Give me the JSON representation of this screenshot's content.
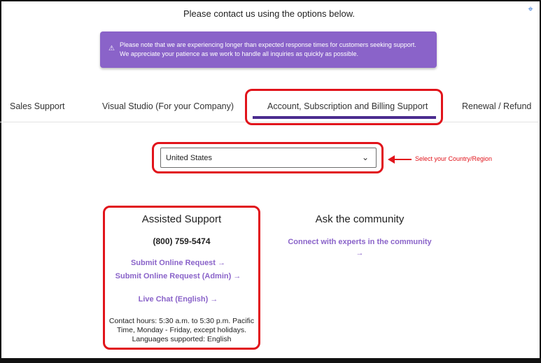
{
  "intro": "Please contact us using the options below.",
  "banner": {
    "icon": "warning-icon",
    "line1": "Please note that we are experiencing longer than expected response times for customers seeking support.",
    "line2": "We appreciate your patience as we work to handle all inquiries as quickly as possible."
  },
  "tabs": [
    {
      "label": "Sales Support"
    },
    {
      "label": "Visual Studio (For your Company)"
    },
    {
      "label": "Account, Subscription and Billing Support",
      "selected": true
    },
    {
      "label": "Renewal / Refund"
    }
  ],
  "country_select": {
    "value": "United States"
  },
  "annotation": {
    "label": "Select your Country/Region",
    "color": "#e1141b"
  },
  "assisted": {
    "title": "Assisted Support",
    "phone": "(800) 759-5474",
    "links": [
      {
        "label": "Submit Online Request",
        "arrow": "→"
      },
      {
        "label": "Submit Online Request (Admin)",
        "arrow": "→"
      },
      {
        "label": "Live Chat (English)",
        "arrow": "→"
      }
    ],
    "hours_line1": "Contact hours: 5:30 a.m. to 5:30 p.m. Pacific",
    "hours_line2": "Time, Monday - Friday, except holidays.",
    "hours_line3": "Languages supported: English"
  },
  "community": {
    "title": "Ask the community",
    "link": "Connect with experts in the community",
    "arrow": "→"
  },
  "colors": {
    "accent": "#8a63c9",
    "tab_underline": "#4b2c8f",
    "annotation_red": "#e1141b"
  }
}
